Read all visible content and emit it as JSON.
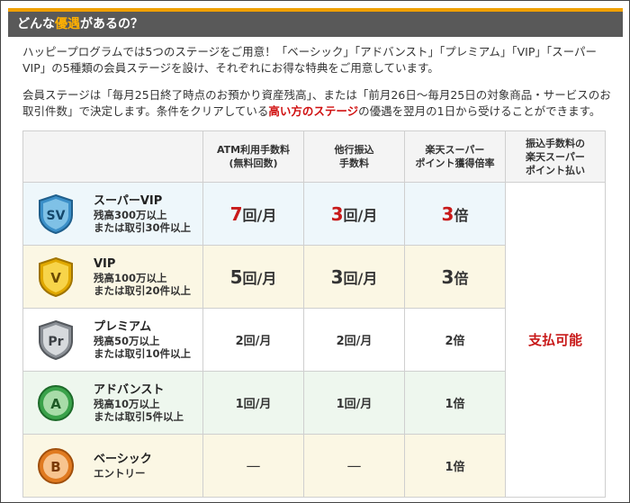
{
  "header": {
    "prefix": "どんな",
    "highlight": "優遇",
    "suffix": "があるの？"
  },
  "intro": "ハッピープログラムでは5つのステージをご用意！「ベーシック」「アドバンスト」「プレミアム」「VIP」「スーパーVIP」の5種類の会員ステージを設け、それぞれにお得な特典をご用意しています。",
  "detail": {
    "before": "会員ステージは「毎月25日終了時点のお預かり資産残高」、または「前月26日～毎月25日の対象商品・サービスのお取引件数」で決定します。条件をクリアしている",
    "highlight": "高い方のステージ",
    "after": "の優遇を翌月の1日から受けることができます。"
  },
  "columns": {
    "atm": "ATM利用手数料（無料回数）",
    "atm_l1": "ATM利用手数料",
    "atm_l2": "(無料回数)",
    "transfer_l1": "他行振込",
    "transfer_l2": "手数料",
    "point_l1": "楽天スーパー",
    "point_l2": "ポイント獲得倍率",
    "pay_l1": "振込手数料の",
    "pay_l2": "楽天スーパー",
    "pay_l3": "ポイント払い"
  },
  "pay_value": "支払可能",
  "unit_times": "回/月",
  "unit_mult": "倍",
  "dash": "—",
  "rows": [
    {
      "badge": "SV",
      "name": "スーパーVIP",
      "cond1": "残高300万以上",
      "cond2": "または取引30件以上",
      "atm": "7",
      "transfer": "3",
      "point": "3",
      "color": "#3b8fc8"
    },
    {
      "badge": "V",
      "name": "VIP",
      "cond1": "残高100万以上",
      "cond2": "または取引20件以上",
      "atm": "5",
      "transfer": "3",
      "point": "3",
      "color": "#e0a800"
    },
    {
      "badge": "Pr",
      "name": "プレミアム",
      "cond1": "残高50万以上",
      "cond2": "または取引10件以上",
      "atm": "2",
      "transfer": "2",
      "point": "2",
      "color": "#8a8f95"
    },
    {
      "badge": "A",
      "name": "アドバンスト",
      "cond1": "残高10万以上",
      "cond2": "または取引5件以上",
      "atm": "1",
      "transfer": "1",
      "point": "1",
      "color": "#3aa24a"
    },
    {
      "badge": "B",
      "name": "ベーシック",
      "cond1": "エントリー",
      "cond2": "",
      "atm": "",
      "transfer": "",
      "point": "1",
      "color": "#e07a20"
    }
  ]
}
